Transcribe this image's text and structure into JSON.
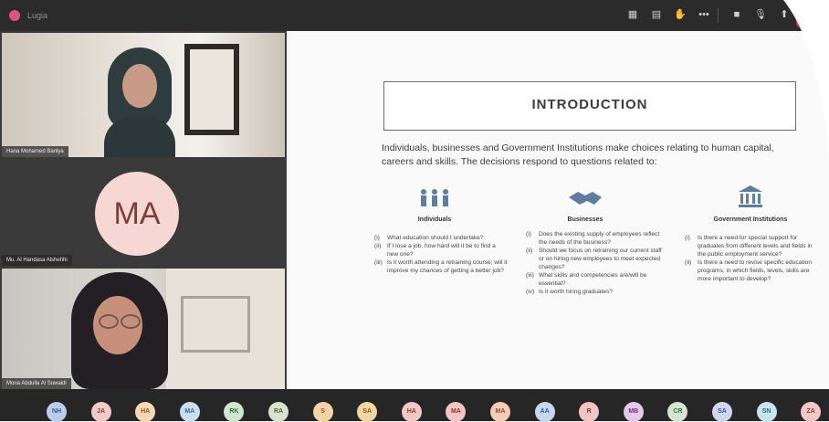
{
  "window": {
    "title": "Lugia"
  },
  "toolbar": {
    "icons": [
      "grid-icon",
      "chat-icon",
      "hand-icon",
      "more-icon",
      "camera-icon",
      "mic-icon",
      "share-icon"
    ],
    "leave_color": "#c4314b"
  },
  "participants_video": [
    {
      "name": "Hana Mohamed Banlya",
      "kind": "video"
    },
    {
      "name": "Mu. Al Handasa Alshehhi",
      "kind": "avatar",
      "initials": "MA"
    },
    {
      "name": "Mona Abdulla Al Suwaidi",
      "kind": "video"
    }
  ],
  "slide": {
    "title": "INTRODUCTION",
    "intro": "Individuals, businesses and Government Institutions make choices relating to human capital, careers and skills. The decisions respond to questions related to:",
    "columns": [
      {
        "heading": "Individuals",
        "icon": "people-icon",
        "items": [
          {
            "num": "(i)",
            "text": "What education should I undertake?"
          },
          {
            "num": "(ii)",
            "text": "If I lose a job, how hard will it be to find a new one?"
          },
          {
            "num": "(iii)",
            "text": "Is it worth attending a retraining course; will it improve my chances of getting a better job?"
          }
        ]
      },
      {
        "heading": "Businesses",
        "icon": "handshake-icon",
        "items": [
          {
            "num": "(i)",
            "text": "Does the existing supply of employees reflect the needs of the business?"
          },
          {
            "num": "(ii)",
            "text": "Should we focus on retraining our current staff or on hiring new employees to meet expected changes?"
          },
          {
            "num": "(iii)",
            "text": "What skills and competencies are/will be essential?"
          },
          {
            "num": "(iv)",
            "text": "Is it worth hiring graduates?"
          }
        ]
      },
      {
        "heading": "Government Institutions",
        "icon": "institution-icon",
        "items": [
          {
            "num": "(i)",
            "text": "Is there a need for special support for graduates from different levels and fields in the public employment service?"
          },
          {
            "num": "(ii)",
            "text": "Is there a need to revise specific education programs; in which fields, levels, skills are more important to develop?"
          }
        ]
      }
    ]
  },
  "participants_strip": [
    {
      "initials": "NH",
      "bg": "#b9cdea",
      "fg": "#3e5c86"
    },
    {
      "initials": "JA",
      "bg": "#f3c9c9",
      "fg": "#8b3c3c"
    },
    {
      "initials": "HA",
      "bg": "#f7d7b4",
      "fg": "#8a5623"
    },
    {
      "initials": "MA",
      "bg": "#c7dff0",
      "fg": "#3a6d8c"
    },
    {
      "initials": "RK",
      "bg": "#cfe6cf",
      "fg": "#3d6e3d"
    },
    {
      "initials": "RA",
      "bg": "#d9e3d0",
      "fg": "#52643f"
    },
    {
      "initials": "S",
      "bg": "#f5d3a8",
      "fg": "#8a5a1e"
    },
    {
      "initials": "SA",
      "bg": "#f2d6a2",
      "fg": "#856025"
    },
    {
      "initials": "HA",
      "bg": "#f3c7c2",
      "fg": "#8a3d35"
    },
    {
      "initials": "MA",
      "bg": "#f3c4c4",
      "fg": "#8a3535"
    },
    {
      "initials": "MA",
      "bg": "#f5ccb5",
      "fg": "#8a4d2c"
    },
    {
      "initials": "AA",
      "bg": "#c6d8ef",
      "fg": "#3a5c88"
    },
    {
      "initials": "R",
      "bg": "#f3c4c4",
      "fg": "#8a3535"
    },
    {
      "initials": "MB",
      "bg": "#e6c8e8",
      "fg": "#6d3c70"
    },
    {
      "initials": "CR",
      "bg": "#d3e5d3",
      "fg": "#44704a"
    },
    {
      "initials": "SA",
      "bg": "#cfd7f0",
      "fg": "#43508a"
    },
    {
      "initials": "SN",
      "bg": "#c7e5ef",
      "fg": "#2f6f83"
    },
    {
      "initials": "ZA",
      "bg": "#f3c7c7",
      "fg": "#8a3a3a"
    }
  ]
}
